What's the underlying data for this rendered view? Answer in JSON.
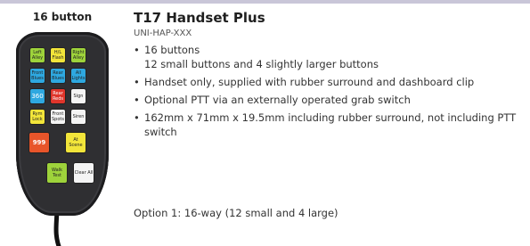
{
  "header": {
    "handset_label": "16 button"
  },
  "product": {
    "title": "T17 Handset Plus",
    "code": "UNI-HAP-XXX",
    "features": [
      {
        "text": "16 buttons",
        "sub": "12 small buttons and 4 slightly larger buttons"
      },
      {
        "text": "Handset only, supplied with rubber surround and dashboard clip",
        "sub": ""
      },
      {
        "text": "Optional PTT via an externally operated grab switch",
        "sub": ""
      },
      {
        "text": "162mm x 71mm x 19.5mm including rubber surround, not including PTT switch",
        "sub": ""
      }
    ],
    "option": {
      "label": "Option 1: 16-way",
      "detail": " (12 small and 4 large)"
    }
  },
  "handset_buttons": [
    {
      "label": "Left Alley",
      "color": "#9ed33b"
    },
    {
      "label": "H/L Flash",
      "color": "#f2e53a"
    },
    {
      "label": "Right Alley",
      "color": "#9ed33b"
    },
    {
      "label": "Front Blues",
      "color": "#2ea8e0"
    },
    {
      "label": "Rear Blues",
      "color": "#2ea8e0"
    },
    {
      "label": "All Lights",
      "color": "#2ea8e0"
    },
    {
      "label": "360",
      "color": "#2ea8e0"
    },
    {
      "label": "Rear Reds",
      "color": "#e0352b"
    },
    {
      "label": "Sign",
      "color": "#f4f4f4"
    },
    {
      "label": "Rym Lock",
      "color": "#f2e53a"
    },
    {
      "label": "Front Spots",
      "color": "#f4f4f4"
    },
    {
      "label": "Siren",
      "color": "#f4f4f4"
    },
    {
      "label": "999",
      "color": "#e8552a"
    },
    {
      "label": "At Scene",
      "color": "#f2e53a"
    },
    {
      "label": "Walk Test",
      "color": "#9ed33b"
    },
    {
      "label": "Clear All",
      "color": "#f4f4f4"
    }
  ],
  "colors": {
    "accent_rule": "#c9c6d8",
    "handset_body": "#2f2f32"
  }
}
